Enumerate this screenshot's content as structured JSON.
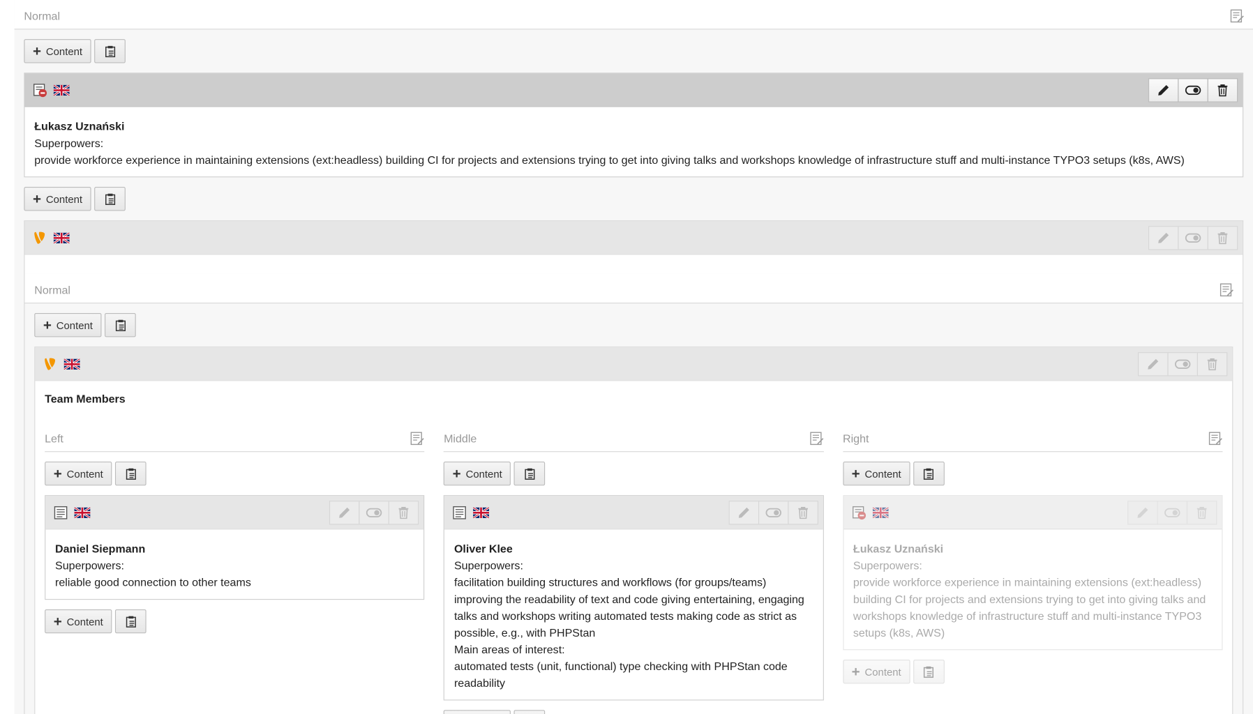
{
  "top_column": {
    "title": "Normal"
  },
  "buttons": {
    "content_label": "Content"
  },
  "element1": {
    "name": "Łukasz Uznański",
    "label": "Superpowers:",
    "text": "provide workforce experience in maintaining extensions (ext:headless) building CI for projects and extensions trying to get into giving talks and workshops knowledge of infrastructure stuff and multi-instance TYPO3 setups (k8s, AWS)"
  },
  "container_outer": {
    "column_title": "Normal"
  },
  "container_inner": {
    "title": "Team Members",
    "columns": [
      {
        "title": "Left"
      },
      {
        "title": "Middle"
      },
      {
        "title": "Right"
      }
    ]
  },
  "members": {
    "daniel": {
      "name": "Daniel Siepmann",
      "label": "Superpowers:",
      "text": "reliable good connection to other teams"
    },
    "oliver": {
      "name": "Oliver Klee",
      "label": "Superpowers:",
      "text": "facilitation building structures and workflows (for groups/teams) improving the readability of text and code giving entertaining, engaging talks and workshops writing automated tests making code as strict as possible, e.g., with PHPStan",
      "label2": "Main areas of interest:",
      "text2": "automated tests (unit, functional) type checking with PHPStan code readability"
    },
    "lukasz": {
      "name": "Łukasz Uznański",
      "label": "Superpowers:",
      "text": "provide workforce experience in maintaining extensions (ext:headless) building CI for projects and extensions trying to get into giving talks and workshops knowledge of infrastructure stuff and multi-instance TYPO3 setups (k8s, AWS)"
    }
  },
  "colors": {
    "typo3_orange": "#f49700",
    "flag_blue": "#012169",
    "flag_red": "#c8102e"
  }
}
